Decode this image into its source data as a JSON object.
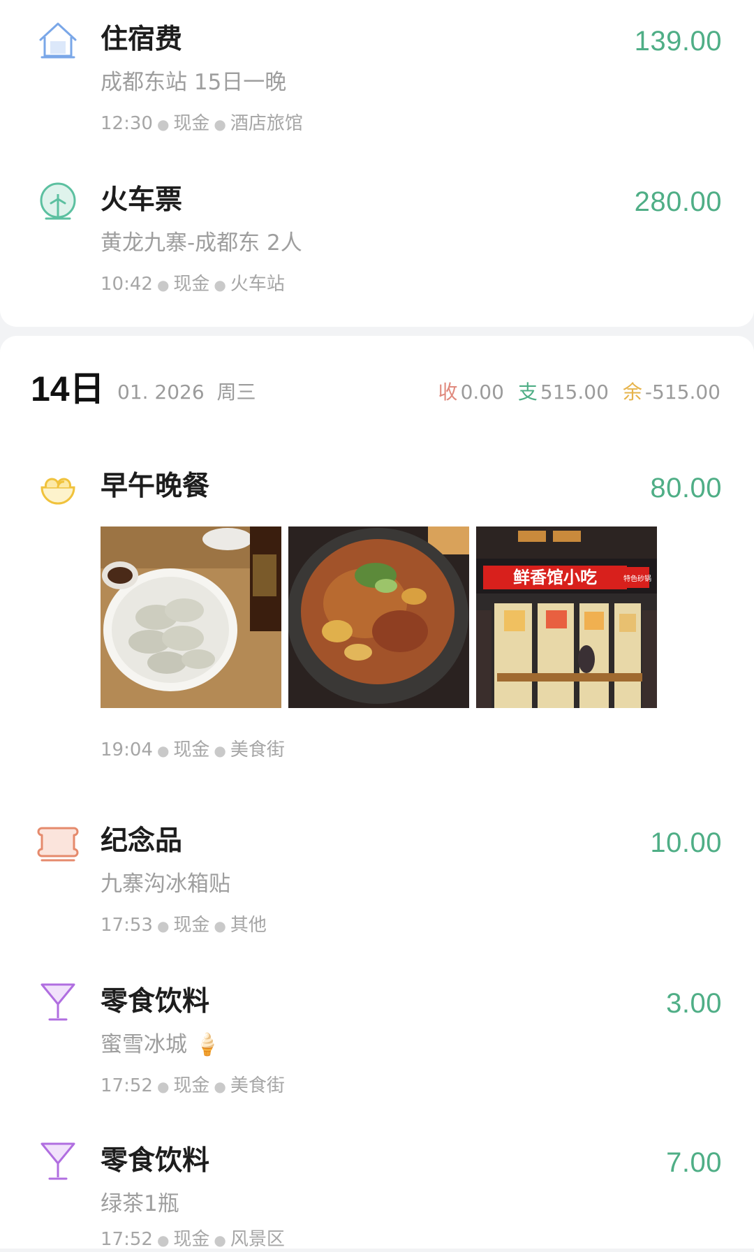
{
  "entries_top": [
    {
      "title": "住宿费",
      "amount": "139.00",
      "note": "成都东站 15日一晚",
      "time": "12:30",
      "payment": "现金",
      "place": "酒店旅馆",
      "icon": "house-icon"
    },
    {
      "title": "火车票",
      "amount": "280.00",
      "note": "黄龙九寨-成都东 2人",
      "time": "10:42",
      "payment": "现金",
      "place": "火车站",
      "icon": "train-icon"
    }
  ],
  "day": {
    "num": "14日",
    "date": "01. 2026",
    "weekday": "周三",
    "income_label": "收",
    "income": "0.00",
    "expense_label": "支",
    "expense": "515.00",
    "balance_label": "余",
    "balance": "-515.00"
  },
  "entries_day": [
    {
      "title": "早午晚餐",
      "amount": "80.00",
      "time": "19:04",
      "payment": "现金",
      "place": "美食街",
      "icon": "meal-bowl-icon",
      "photos": [
        "dumplings-photo",
        "stew-pot-photo",
        "restaurant-storefront-photo"
      ],
      "storefront_sign": "鲜香馆小吃",
      "storefront_sign_small": "特色砂锅"
    },
    {
      "title": "纪念品",
      "amount": "10.00",
      "note": "九寨沟冰箱贴",
      "time": "17:53",
      "payment": "现金",
      "place": "其他",
      "icon": "souvenir-icon"
    },
    {
      "title": "零食饮料",
      "amount": "3.00",
      "note": "蜜雪冰城 🍦",
      "time": "17:52",
      "payment": "现金",
      "place": "美食街",
      "icon": "cocktail-glass-icon"
    },
    {
      "title": "零食饮料",
      "amount": "7.00",
      "note": "绿茶1瓶",
      "time": "17:52",
      "payment": "现金",
      "place": "风景区",
      "icon": "cocktail-glass-icon"
    }
  ],
  "colors": {
    "amount": "#4fae86",
    "income": "#e08a7e",
    "expense": "#4fae86",
    "balance": "#e6b34a",
    "house_icon": "#7aa7e8",
    "train_icon": "#5cc0a0",
    "meal_icon": "#f0c23c",
    "souvenir_icon": "#e58a6c",
    "drink_icon": "#b06ee0"
  }
}
